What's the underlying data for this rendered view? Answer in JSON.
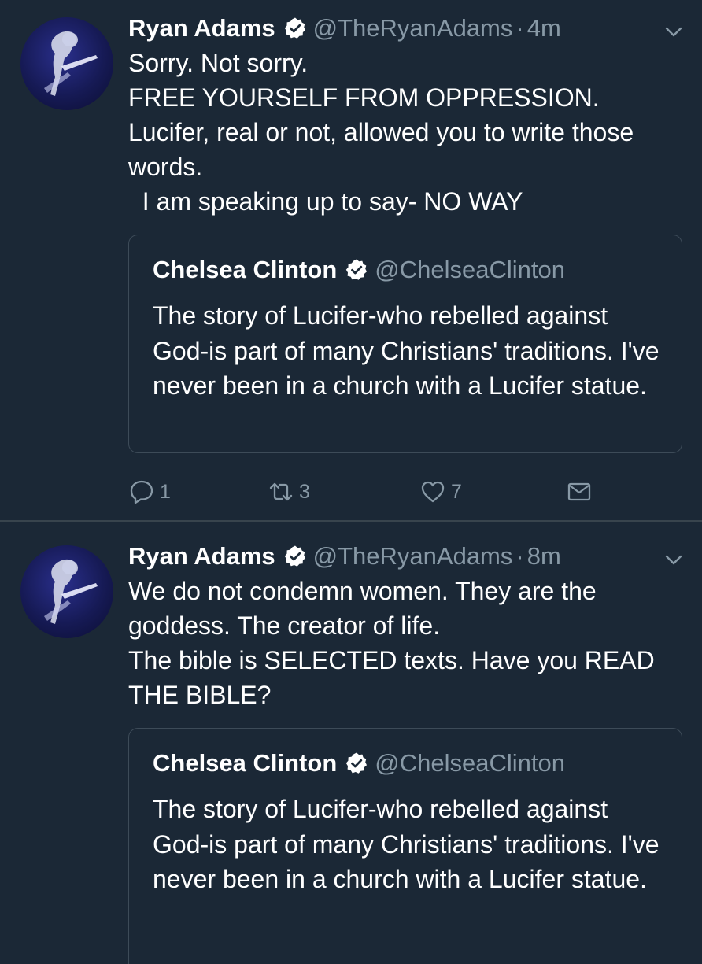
{
  "tweets": [
    {
      "author": {
        "name": "Ryan Adams",
        "handle": "@TheRyanAdams",
        "separator": "·",
        "time": "4m"
      },
      "text": "Sorry. Not sorry.\nFREE YOURSELF FROM OPPRESSION.\nLucifer, real or not, allowed you to write those words.\n  I am speaking up to say- NO WAY",
      "quote": {
        "name": "Chelsea Clinton",
        "handle": "@ChelseaClinton",
        "text": "The story of Lucifer-who rebelled against God-is part of many Christians' traditions. I've never been in a church with a Lucifer statue."
      },
      "actions": {
        "reply_count": "1",
        "retweet_count": "3",
        "like_count": "7"
      }
    },
    {
      "author": {
        "name": "Ryan Adams",
        "handle": "@TheRyanAdams",
        "separator": "·",
        "time": "8m"
      },
      "text": "We do not condemn women. They are the goddess. The creator of life.\nThe bible is SELECTED texts. Have you READ THE BIBLE?",
      "quote": {
        "name": "Chelsea Clinton",
        "handle": "@ChelseaClinton",
        "text": "The story of Lucifer-who rebelled against God-is part of many Christians' traditions. I've never been in a church with a Lucifer statue."
      }
    }
  ],
  "colors": {
    "background": "#1b2836",
    "text": "#ffffff",
    "secondary": "#8899a6",
    "border": "#38444d"
  },
  "icons": {
    "verified": "verified-badge-icon",
    "menu": "chevron-down-icon",
    "reply": "reply-icon",
    "retweet": "retweet-icon",
    "like": "heart-icon",
    "dm": "envelope-icon"
  }
}
